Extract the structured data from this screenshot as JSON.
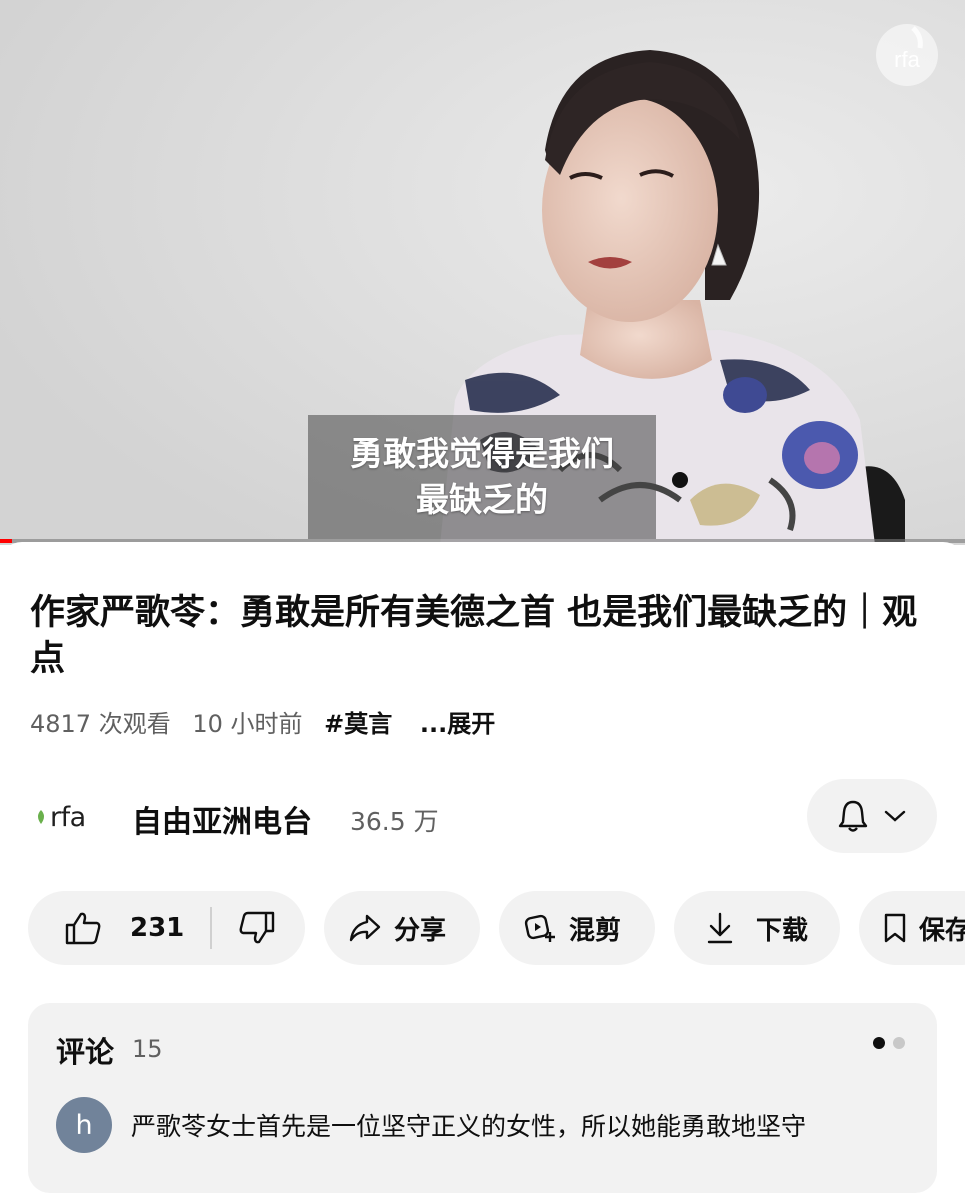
{
  "video": {
    "watermark": "rfa",
    "subtitle_line1": "勇敢我觉得是我们",
    "subtitle_line2": "最缺乏的",
    "progress_fraction": 0.012,
    "progress_color": "#ff0000"
  },
  "title": "作家严歌苓：勇敢是所有美德之首 也是我们最缺乏的｜观点",
  "meta": {
    "views": "4817 次观看",
    "time": "10 小时前",
    "hashtag": "#莫言",
    "expand": "...展开"
  },
  "channel": {
    "logo_text": "rfa",
    "logo_color": "#6ab04c",
    "name": "自由亚洲电台",
    "subscribers": "36.5 万",
    "bell_icon": "bell-icon",
    "chevron_icon": "chevron-down-icon"
  },
  "actions": {
    "like_count": "231",
    "share_label": "分享",
    "remix_label": "混剪",
    "download_label": "下载",
    "save_label": "保存"
  },
  "comments": {
    "title": "评论",
    "count": "15",
    "first_avatar_letter": "h",
    "first_comment": "严歌苓女士首先是一位坚守正义的女性，所以她能勇敢地坚守"
  }
}
